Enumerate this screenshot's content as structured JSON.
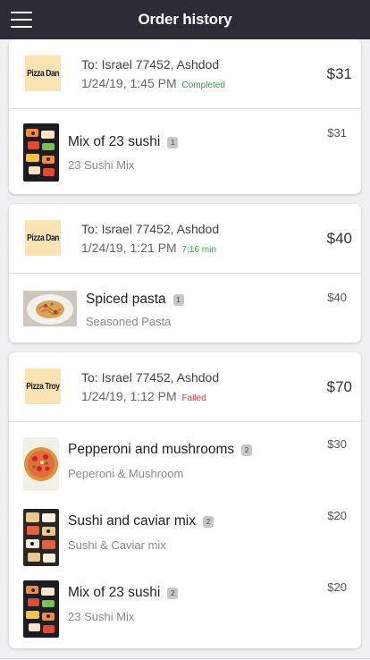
{
  "appbar": {
    "title": "Order history",
    "menu_icon": "hamburger-menu-icon"
  },
  "orders": [
    {
      "logo_text": "Pizza Dan",
      "destination": "To: Israel 77452, Ashdod",
      "datetime": "1/24/19, 1:45 PM",
      "status": "Completed",
      "total": "$31",
      "items": [
        {
          "name": "Mix of 23 sushi",
          "qty": "1",
          "subtitle": "23 Sushi Mix",
          "price": "$31",
          "image": "sushi-mix-photo"
        }
      ]
    },
    {
      "logo_text": "Pizza Dan",
      "destination": "To: Israel 77452, Ashdod",
      "datetime": "1/24/19, 1:21 PM",
      "status": "7:16 min",
      "total": "$40",
      "items": [
        {
          "name": "Spiced pasta",
          "qty": "1",
          "subtitle": "Seasoned Pasta",
          "price": "$40",
          "image": "pasta-photo"
        }
      ]
    },
    {
      "logo_text": "Pizza Troy",
      "destination": "To: Israel 77452, Ashdod",
      "datetime": "1/24/19, 1:12 PM",
      "status": "Failed",
      "total": "$70",
      "items": [
        {
          "name": "Pepperoni and mushrooms",
          "qty": "2",
          "subtitle": "Peperoni & Mushroom",
          "price": "$30",
          "image": "pizza-photo"
        },
        {
          "name": "Sushi and caviar mix",
          "qty": "2",
          "subtitle": "Sushi & Caviar mix",
          "price": "$20",
          "image": "sushi-caviar-photo"
        },
        {
          "name": "Mix of 23 sushi",
          "qty": "2",
          "subtitle": "23 Sushi Mix",
          "price": "$20",
          "image": "sushi-mix-photo"
        }
      ]
    }
  ],
  "colors": {
    "appbar_bg": "#2a2d35",
    "status_ok": "#2eaa3d",
    "status_failed": "#e0393d",
    "logo_bg": "#fbe4b4"
  }
}
